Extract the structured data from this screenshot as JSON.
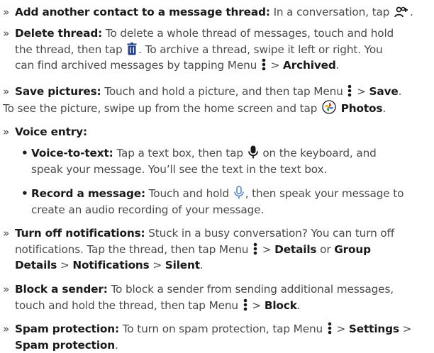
{
  "add_contact": {
    "title": "Add another contact to a message thread:",
    "text": "In a conversation, tap",
    "end": "."
  },
  "delete_thread": {
    "title": "Delete thread:",
    "l1": "To delete a whole thread of messages, touch and hold",
    "l2a": "the thread, then tap",
    "l2b": ". To archive a thread, swipe it left or right. You",
    "l3a": "can find archived messages by tapping Menu",
    "l3b": ">",
    "l3c": "Archived",
    "l3d": "."
  },
  "save_pictures": {
    "title": "Save pictures:",
    "l1a": "Touch and hold a picture, and then tap Menu",
    "l1b": ">",
    "l1c": "Save",
    "l1d": ".",
    "l2a": "To see the picture, swipe up from the home screen and tap",
    "l2b": "Photos",
    "l2c": "."
  },
  "voice_entry": {
    "title": "Voice entry:",
    "vtt": {
      "title": "Voice-to-text:",
      "l1a": "Tap a text box, then tap",
      "l1b": "on the keyboard, and",
      "l2": "speak your message. You’ll see the text in the text box."
    },
    "record": {
      "title": "Record a message:",
      "l1a": "Touch and hold",
      "l1b": ", then speak your message to",
      "l2": "create an audio recording of your message."
    }
  },
  "turn_off": {
    "title": "Turn off notifications:",
    "l1": "Stuck in a busy conversation? You can turn off",
    "l2a": "notifications. Tap the thread, then tap Menu",
    "l2b": ">",
    "l2c": "Details",
    "l2d": "or",
    "l2e": "Group",
    "l3a": "Details",
    "l3b": ">",
    "l3c": "Notifications",
    "l3d": ">",
    "l3e": "Silent",
    "l3f": "."
  },
  "block": {
    "title": "Block a sender:",
    "l1": "To block a sender from sending additional messages,",
    "l2a": "touch and hold the thread, then tap Menu",
    "l2b": ">",
    "l2c": "Block",
    "l2d": "."
  },
  "spam": {
    "title": "Spam protection:",
    "l1a": "To turn on spam protection, tap Menu",
    "l1b": ">",
    "l1c": "Settings",
    "l1d": ">",
    "l2a": "Spam protection",
    "l2b": "."
  },
  "bullet_char": "»",
  "dot_char": "•",
  "icons": [
    "add-contact-icon",
    "trash-icon",
    "menu-icon",
    "photos-icon",
    "microphone-icon",
    "microphone-outline-icon"
  ],
  "colors": {
    "text": "#4a4a4a",
    "bold": "#1a1a1a",
    "icon": "#1f3f8f"
  }
}
